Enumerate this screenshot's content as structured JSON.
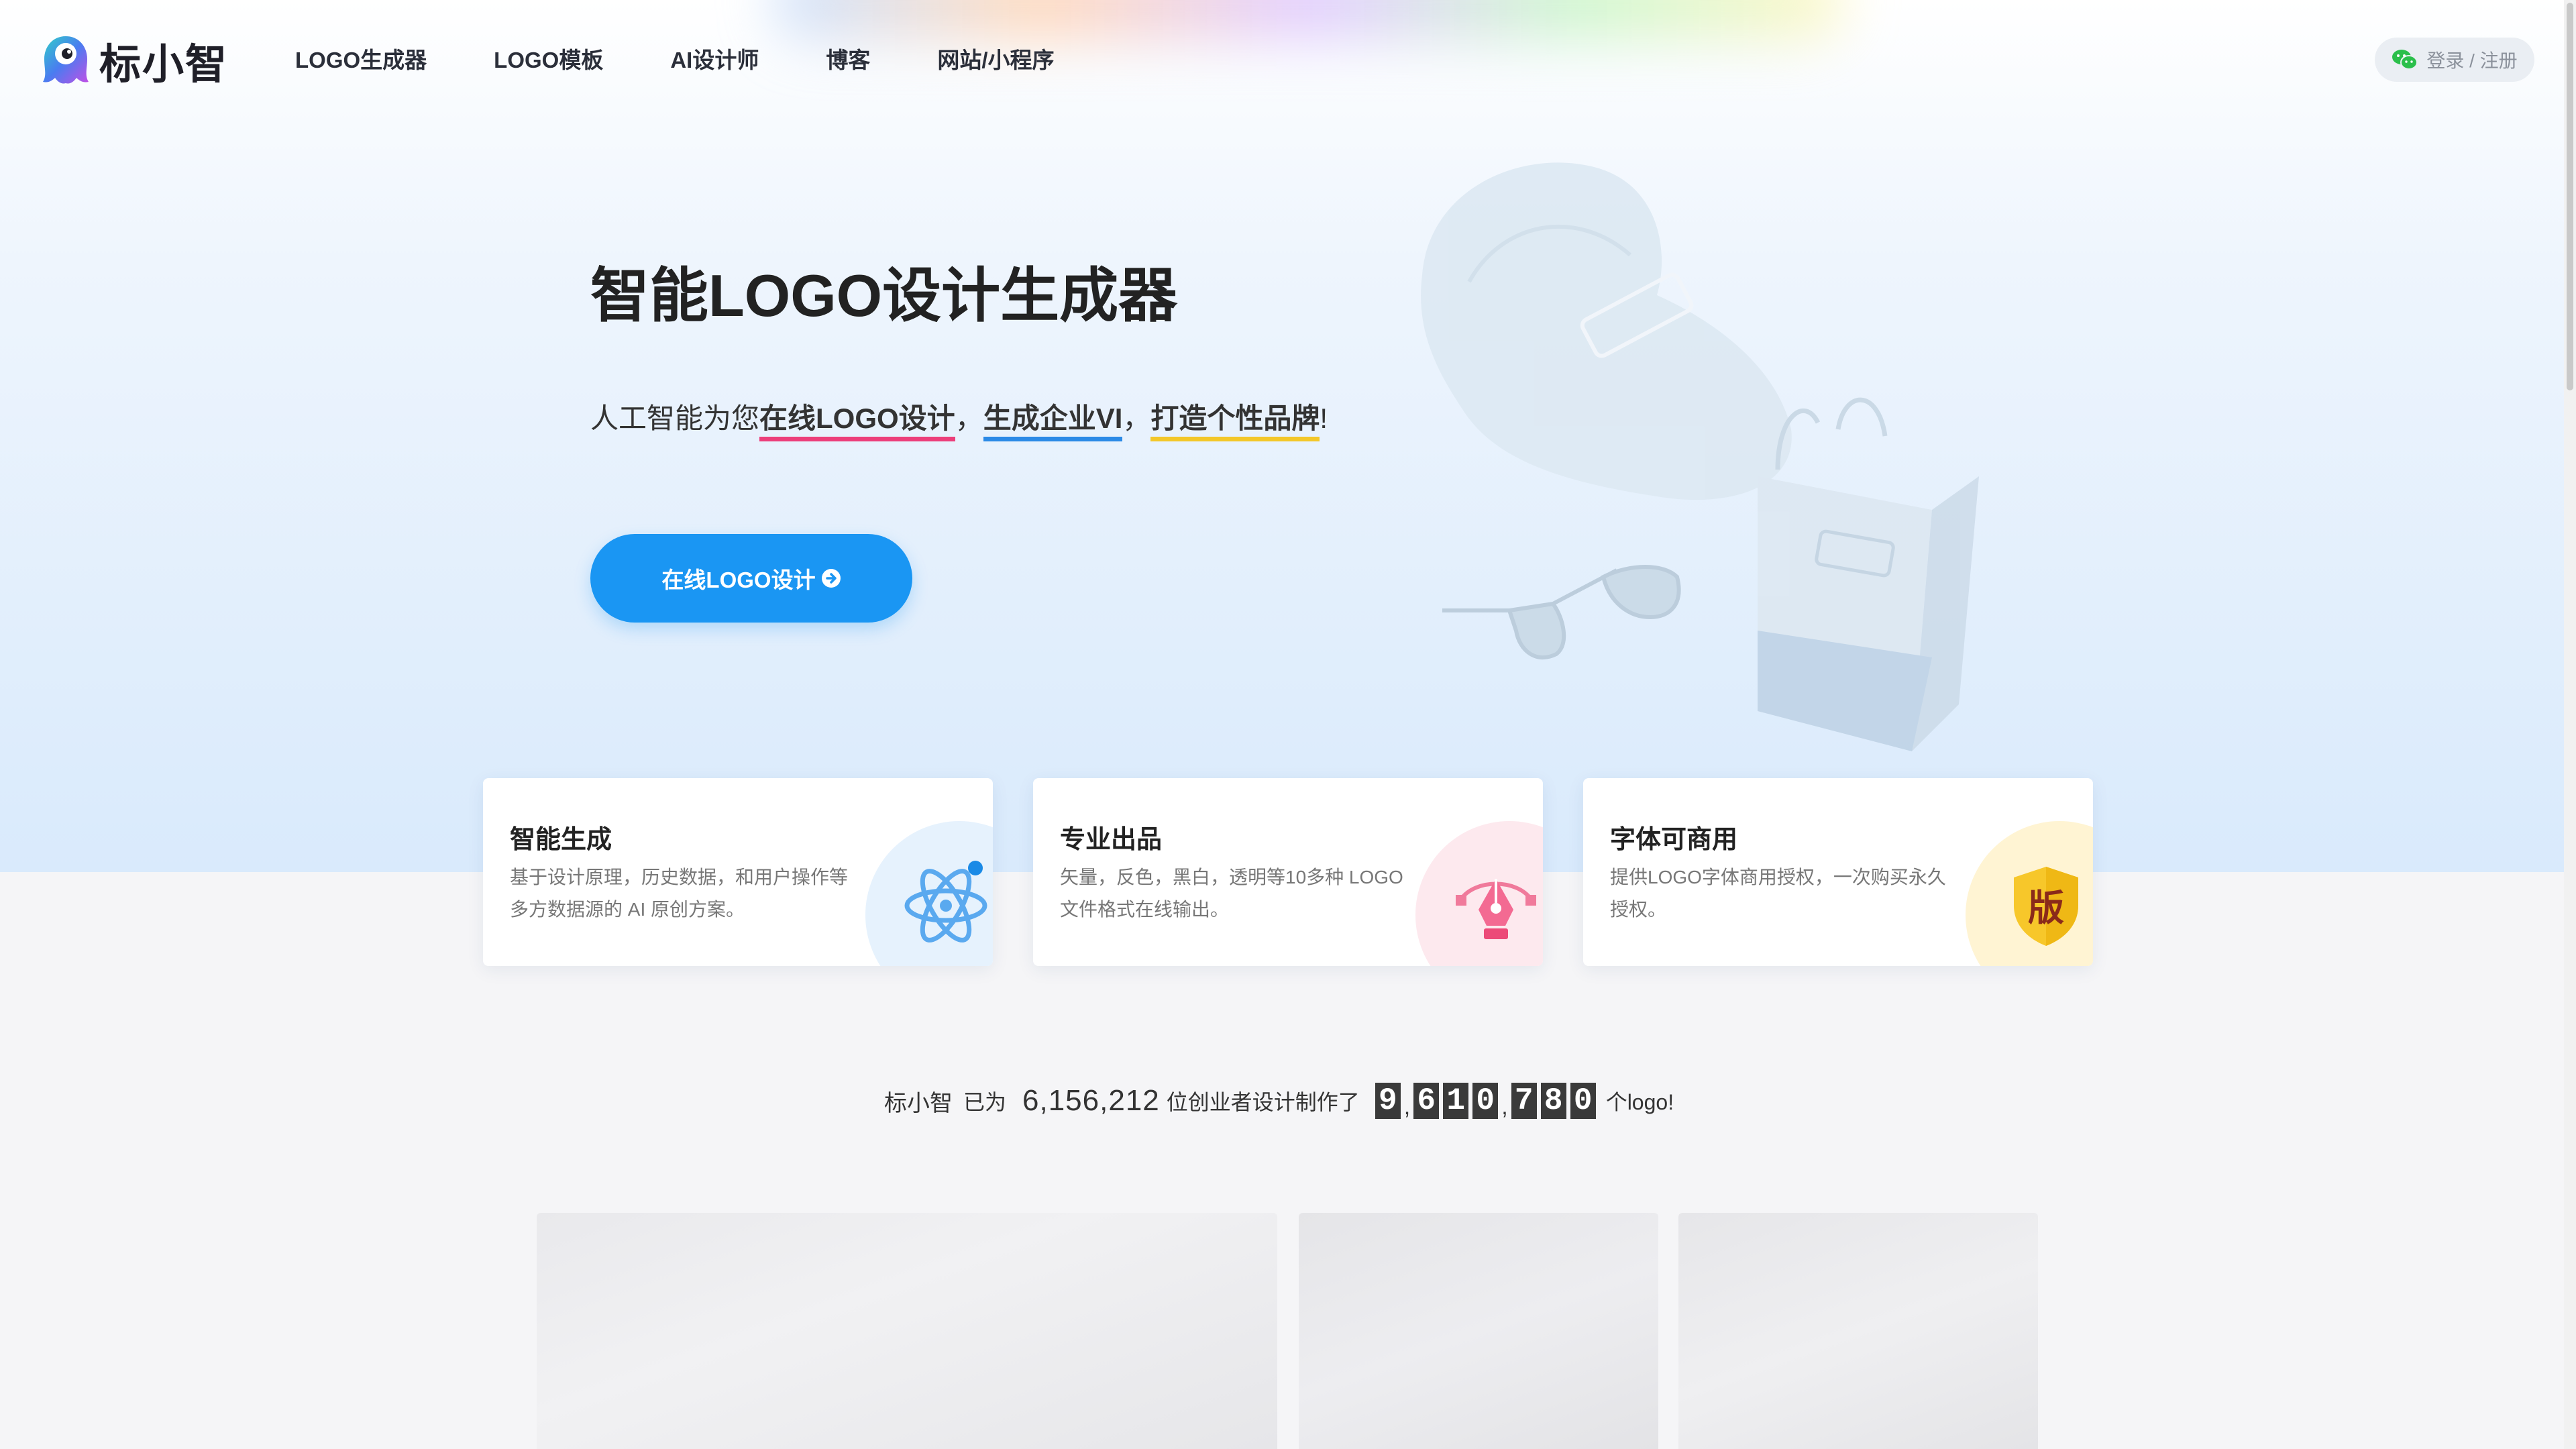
{
  "header": {
    "logo_text": "标小智",
    "nav": [
      {
        "label": "LOGO生成器"
      },
      {
        "label": "LOGO模板"
      },
      {
        "label": "AI设计师"
      },
      {
        "label": "博客"
      },
      {
        "label": "网站/小程序"
      }
    ],
    "login_label": "登录 / 注册",
    "login_icon": "wechat-icon"
  },
  "hero": {
    "title": "智能LOGO设计生成器",
    "subtitle": {
      "part1": "人工智能为您",
      "highlight1": "在线LOGO设计",
      "sep1": "，",
      "highlight2": "生成企业VI",
      "sep2": "，",
      "highlight3": "打造个性品牌",
      "end": "!"
    },
    "cta_label": "在线LOGO设计",
    "cta_icon": "arrow-circle-right-icon"
  },
  "features": [
    {
      "title": "智能生成",
      "desc": "基于设计原理，历史数据，和用户操作等多方数据源的 AI 原创方案。",
      "icon": "atom-icon",
      "accent": "#2b8ae6"
    },
    {
      "title": "专业出品",
      "desc": "矢量，反色，黑白，透明等10多种 LOGO 文件格式在线输出。",
      "icon": "pen-tool-icon",
      "accent": "#ec4a78"
    },
    {
      "title": "字体可商用",
      "desc": "提供LOGO字体商用授权，一次购买永久授权。",
      "icon": "copyright-shield-icon",
      "badge_text": "版",
      "accent": "#f3c729"
    }
  ],
  "counter": {
    "brand": "标小智",
    "already": "已为",
    "founders": "6,156,212",
    "designed": "位创业者设计制作了",
    "logo_digits": [
      [
        "9"
      ],
      [
        "6",
        "1",
        "0"
      ],
      [
        "7",
        "8",
        "0"
      ]
    ],
    "separator": ",",
    "suffix": "个logo!"
  }
}
